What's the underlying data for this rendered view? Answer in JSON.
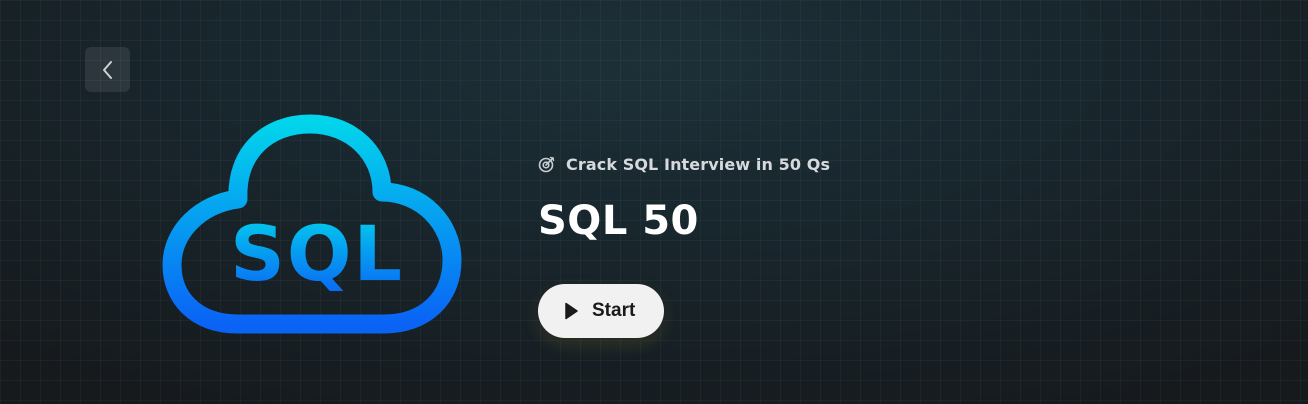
{
  "header": {
    "back_icon": "chevron-left-icon"
  },
  "logo": {
    "text": "SQL",
    "icon": "cloud-icon",
    "gradient_top": "#02d4ec",
    "gradient_bottom": "#0a63f5"
  },
  "study_plan": {
    "subtitle": "Crack SQL Interview in 50 Qs",
    "subtitle_icon": "target-icon",
    "title": "SQL 50",
    "start_button": {
      "label": "Start",
      "icon": "play-icon"
    }
  },
  "colors": {
    "background": "#171b1e",
    "button_bg": "#f1f1f1",
    "title_text": "#ffffff"
  }
}
